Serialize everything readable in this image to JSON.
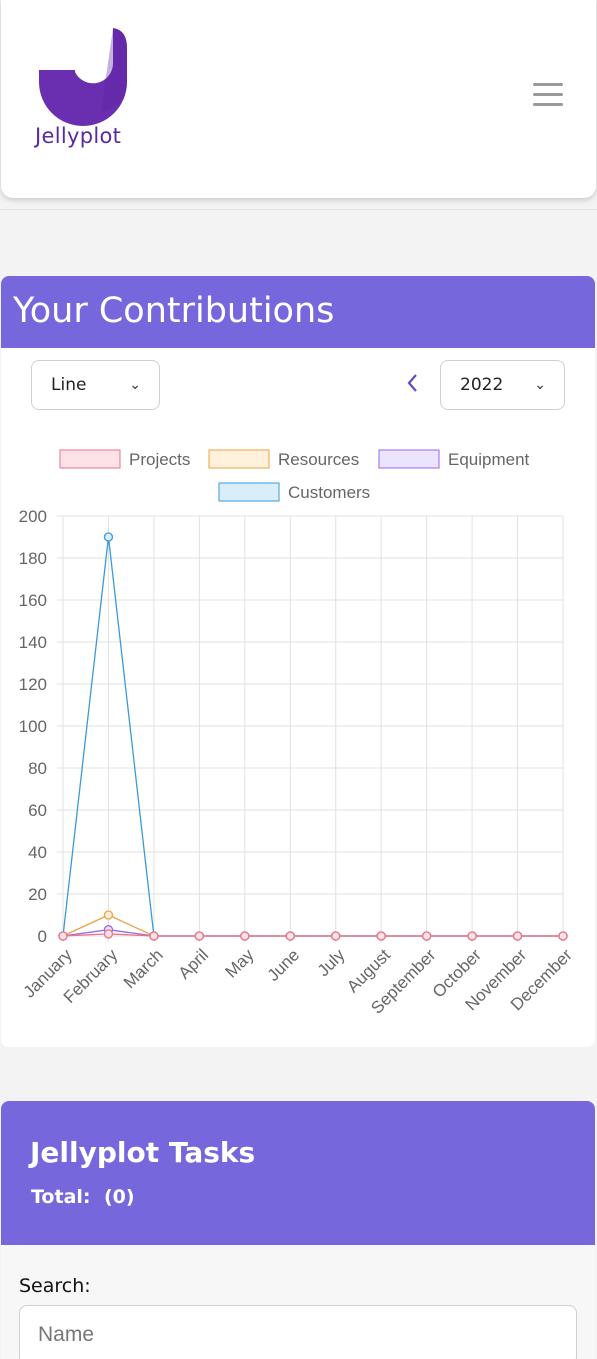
{
  "header": {
    "logo_text": "Jellyplot"
  },
  "contributions": {
    "title": "Your Contributions",
    "chart_type_select": "Line",
    "year_select": "2022"
  },
  "chart_data": {
    "type": "line",
    "categories": [
      "January",
      "February",
      "March",
      "April",
      "May",
      "June",
      "July",
      "August",
      "September",
      "October",
      "November",
      "December"
    ],
    "ylim": [
      0,
      200
    ],
    "yticks": [
      "200",
      "180",
      "160",
      "140",
      "120",
      "100",
      "80",
      "60",
      "40",
      "20",
      "0"
    ],
    "legend_position": "top",
    "grid": true,
    "series": [
      {
        "name": "Projects",
        "color": "#e8738a",
        "fill": "#fde2e7",
        "values": [
          0,
          1,
          0,
          0,
          0,
          0,
          0,
          0,
          0,
          0,
          0,
          0
        ]
      },
      {
        "name": "Resources",
        "color": "#f0a040",
        "fill": "#fff1dc",
        "values": [
          0,
          10,
          0,
          0,
          0,
          0,
          0,
          0,
          0,
          0,
          0,
          0
        ]
      },
      {
        "name": "Equipment",
        "color": "#9966ee",
        "fill": "#ece3fd",
        "values": [
          0,
          3,
          0,
          0,
          0,
          0,
          0,
          0,
          0,
          0,
          0,
          0
        ]
      },
      {
        "name": "Customers",
        "color": "#3b9ad8",
        "fill": "#d9eef9",
        "values": [
          0,
          190,
          0,
          0,
          0,
          0,
          0,
          0,
          0,
          0,
          0,
          0
        ]
      }
    ]
  },
  "tasks": {
    "title": "Jellyplot Tasks",
    "total_label": "Total:",
    "total_value": "(0)",
    "search_label": "Search:",
    "search_placeholder": "Name"
  }
}
